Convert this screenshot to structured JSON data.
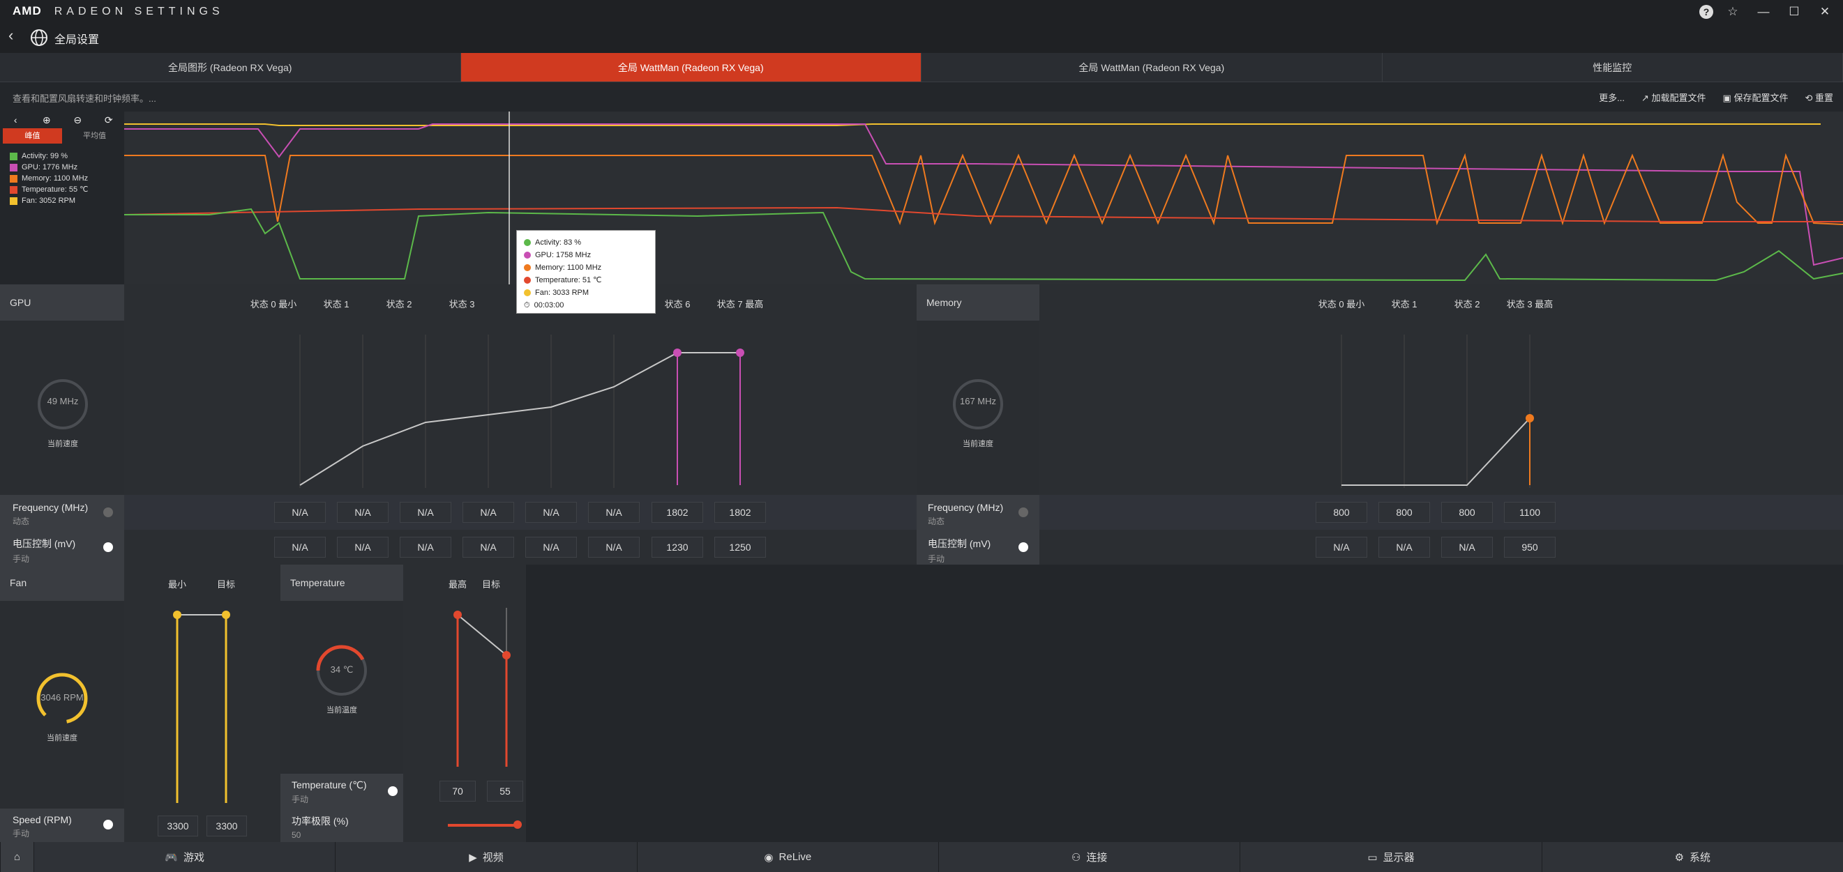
{
  "app": {
    "brand": "AMD",
    "title": "RADEON SETTINGS"
  },
  "header": {
    "title": "全局设置"
  },
  "tabs": [
    {
      "label": "全局图形 (Radeon RX Vega)",
      "active": false
    },
    {
      "label": "全局 WattMan (Radeon RX Vega)",
      "active": true
    },
    {
      "label": "全局 WattMan (Radeon RX Vega)",
      "active": false
    },
    {
      "label": "性能监控",
      "active": false
    }
  ],
  "subbar": {
    "description": "查看和配置风扇转速和时钟频率。...",
    "more": "更多...",
    "load_profile": "加载配置文件",
    "save_profile": "保存配置文件",
    "reset": "重置"
  },
  "graph": {
    "toggle_peak": "峰值",
    "toggle_avg": "平均值",
    "legend": [
      {
        "label": "Activity: 99 %",
        "color": "#5cb94a"
      },
      {
        "label": "GPU: 1776 MHz",
        "color": "#c94fb4"
      },
      {
        "label": "Memory: 1100 MHz",
        "color": "#ef7a1f"
      },
      {
        "label": "Temperature: 55 ℃",
        "color": "#e2482e"
      },
      {
        "label": "Fan: 3052 RPM",
        "color": "#f2c12e"
      }
    ],
    "tooltip": [
      {
        "label": "Activity: 83 %",
        "color": "#5cb94a"
      },
      {
        "label": "GPU: 1758 MHz",
        "color": "#c94fb4"
      },
      {
        "label": "Memory: 1100 MHz",
        "color": "#ef7a1f"
      },
      {
        "label": "Temperature: 51 ℃",
        "color": "#e2482e"
      },
      {
        "label": "Fan: 3033 RPM",
        "color": "#f2c12e"
      }
    ],
    "tooltip_time": "00:03:00"
  },
  "gpu": {
    "title": "GPU",
    "states": [
      "状态 0 最小",
      "状态 1",
      "状态 2",
      "状态 3",
      "",
      "",
      "状态 6",
      "状态 7 最高"
    ],
    "gauge_value": "49 MHz",
    "gauge_label": "当前速度",
    "freq_label": "Frequency (MHz)",
    "freq_mode": "动态",
    "freq_values": [
      "N/A",
      "N/A",
      "N/A",
      "N/A",
      "N/A",
      "N/A",
      "1802",
      "1802"
    ],
    "volt_label": "电压控制 (mV)",
    "volt_mode": "手动",
    "volt_values": [
      "N/A",
      "N/A",
      "N/A",
      "N/A",
      "N/A",
      "N/A",
      "1230",
      "1250"
    ]
  },
  "memory": {
    "title": "Memory",
    "states": [
      "状态 0 最小",
      "状态 1",
      "状态 2",
      "状态 3 最高"
    ],
    "gauge_value": "167 MHz",
    "gauge_label": "当前速度",
    "freq_label": "Frequency (MHz)",
    "freq_mode": "动态",
    "freq_values": [
      "800",
      "800",
      "800",
      "1100"
    ],
    "volt_label": "电压控制 (mV)",
    "volt_mode": "手动",
    "volt_values": [
      "N/A",
      "N/A",
      "N/A",
      "950"
    ]
  },
  "fan": {
    "title": "Fan",
    "col_min": "最小",
    "col_target": "目标",
    "gauge_value": "3046 RPM",
    "gauge_label": "当前速度",
    "speed_label": "Speed (RPM)",
    "speed_mode": "手动",
    "min_value": "3300",
    "target_value": "3300"
  },
  "temperature": {
    "title": "Temperature",
    "col_max": "最高",
    "col_target": "目标",
    "gauge_value": "34 ℃",
    "gauge_label": "当前温度",
    "temp_label": "Temperature (℃)",
    "temp_mode": "手动",
    "max_value": "70",
    "target_value": "55",
    "power_label": "功率极限 (%)",
    "power_value": "50"
  },
  "bottom_nav": [
    {
      "label": "游戏",
      "icon": "gamepad-icon"
    },
    {
      "label": "视频",
      "icon": "play-icon"
    },
    {
      "label": "ReLive",
      "icon": "relive-icon"
    },
    {
      "label": "连接",
      "icon": "share-icon"
    },
    {
      "label": "显示器",
      "icon": "monitor-icon"
    },
    {
      "label": "系统",
      "icon": "system-icon"
    }
  ]
}
